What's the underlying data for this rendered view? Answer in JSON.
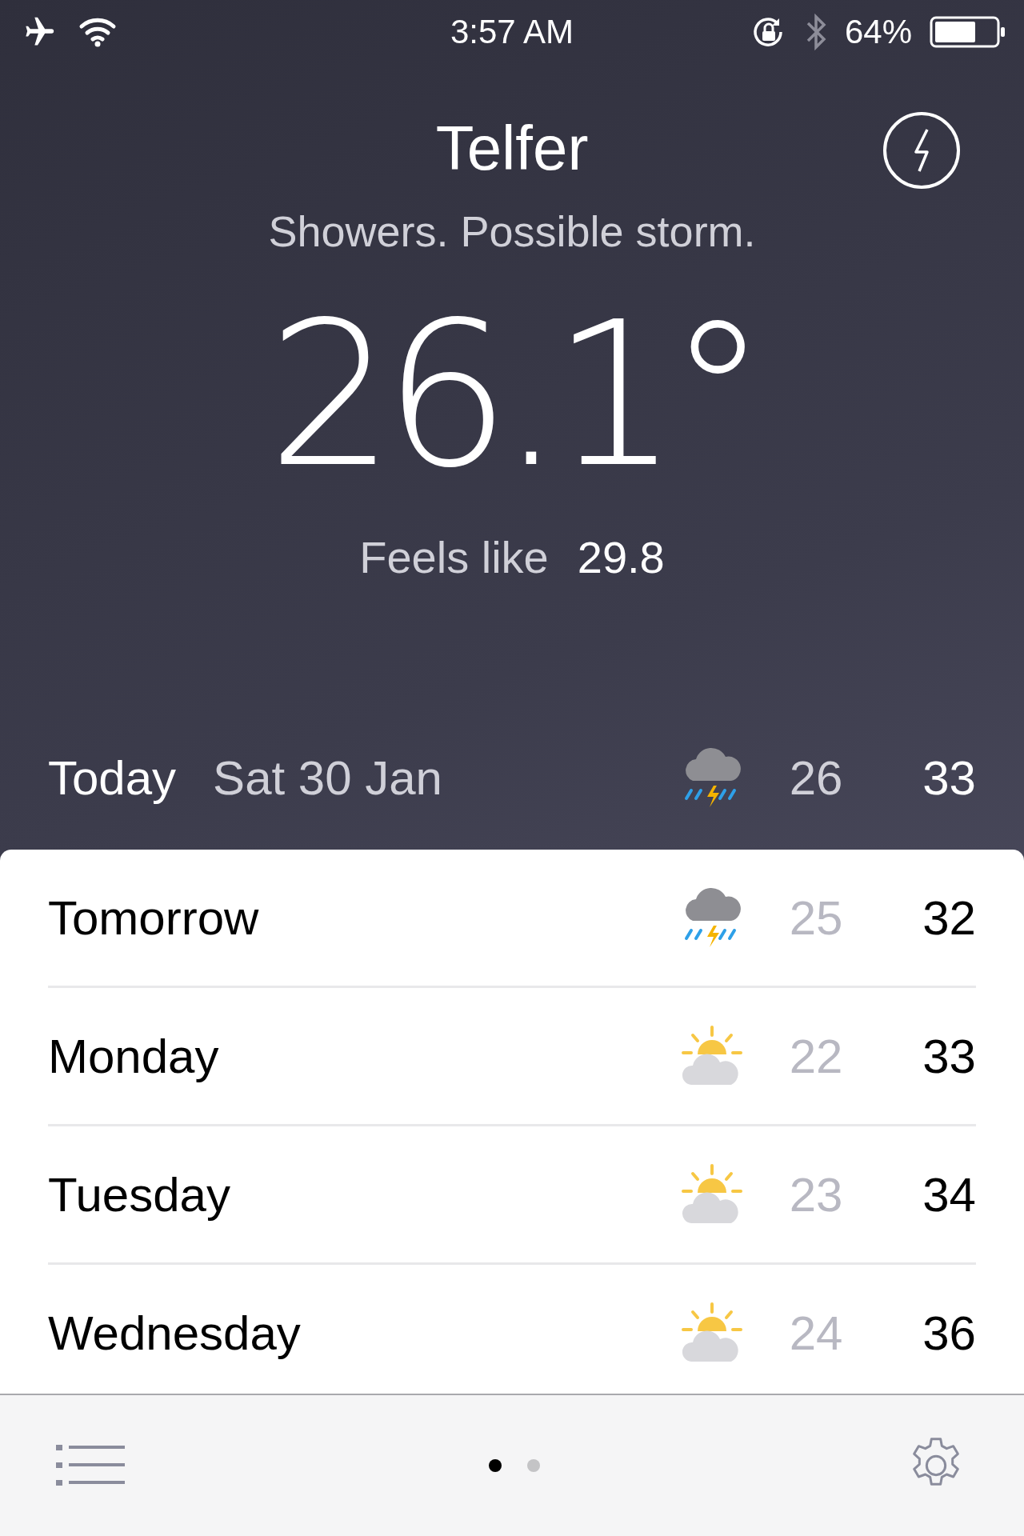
{
  "status_bar": {
    "time": "3:57 AM",
    "battery_percent": "64%"
  },
  "location": {
    "name": "Telfer",
    "summary": "Showers. Possible storm."
  },
  "current": {
    "temperature": "26.1°",
    "feels_like_label": "Feels like",
    "feels_like_value": "29.8"
  },
  "today": {
    "label": "Today",
    "date": "Sat 30 Jan",
    "kind": "storm",
    "low": "26",
    "high": "33"
  },
  "forecast": [
    {
      "day": "Tomorrow",
      "kind": "storm",
      "low": "25",
      "high": "32"
    },
    {
      "day": "Monday",
      "kind": "sunny",
      "low": "22",
      "high": "33"
    },
    {
      "day": "Tuesday",
      "kind": "sunny",
      "low": "23",
      "high": "34"
    },
    {
      "day": "Wednesday",
      "kind": "sunny",
      "low": "24",
      "high": "36"
    }
  ],
  "page_dots": [
    {
      "selected": true
    },
    {
      "selected": false
    }
  ]
}
